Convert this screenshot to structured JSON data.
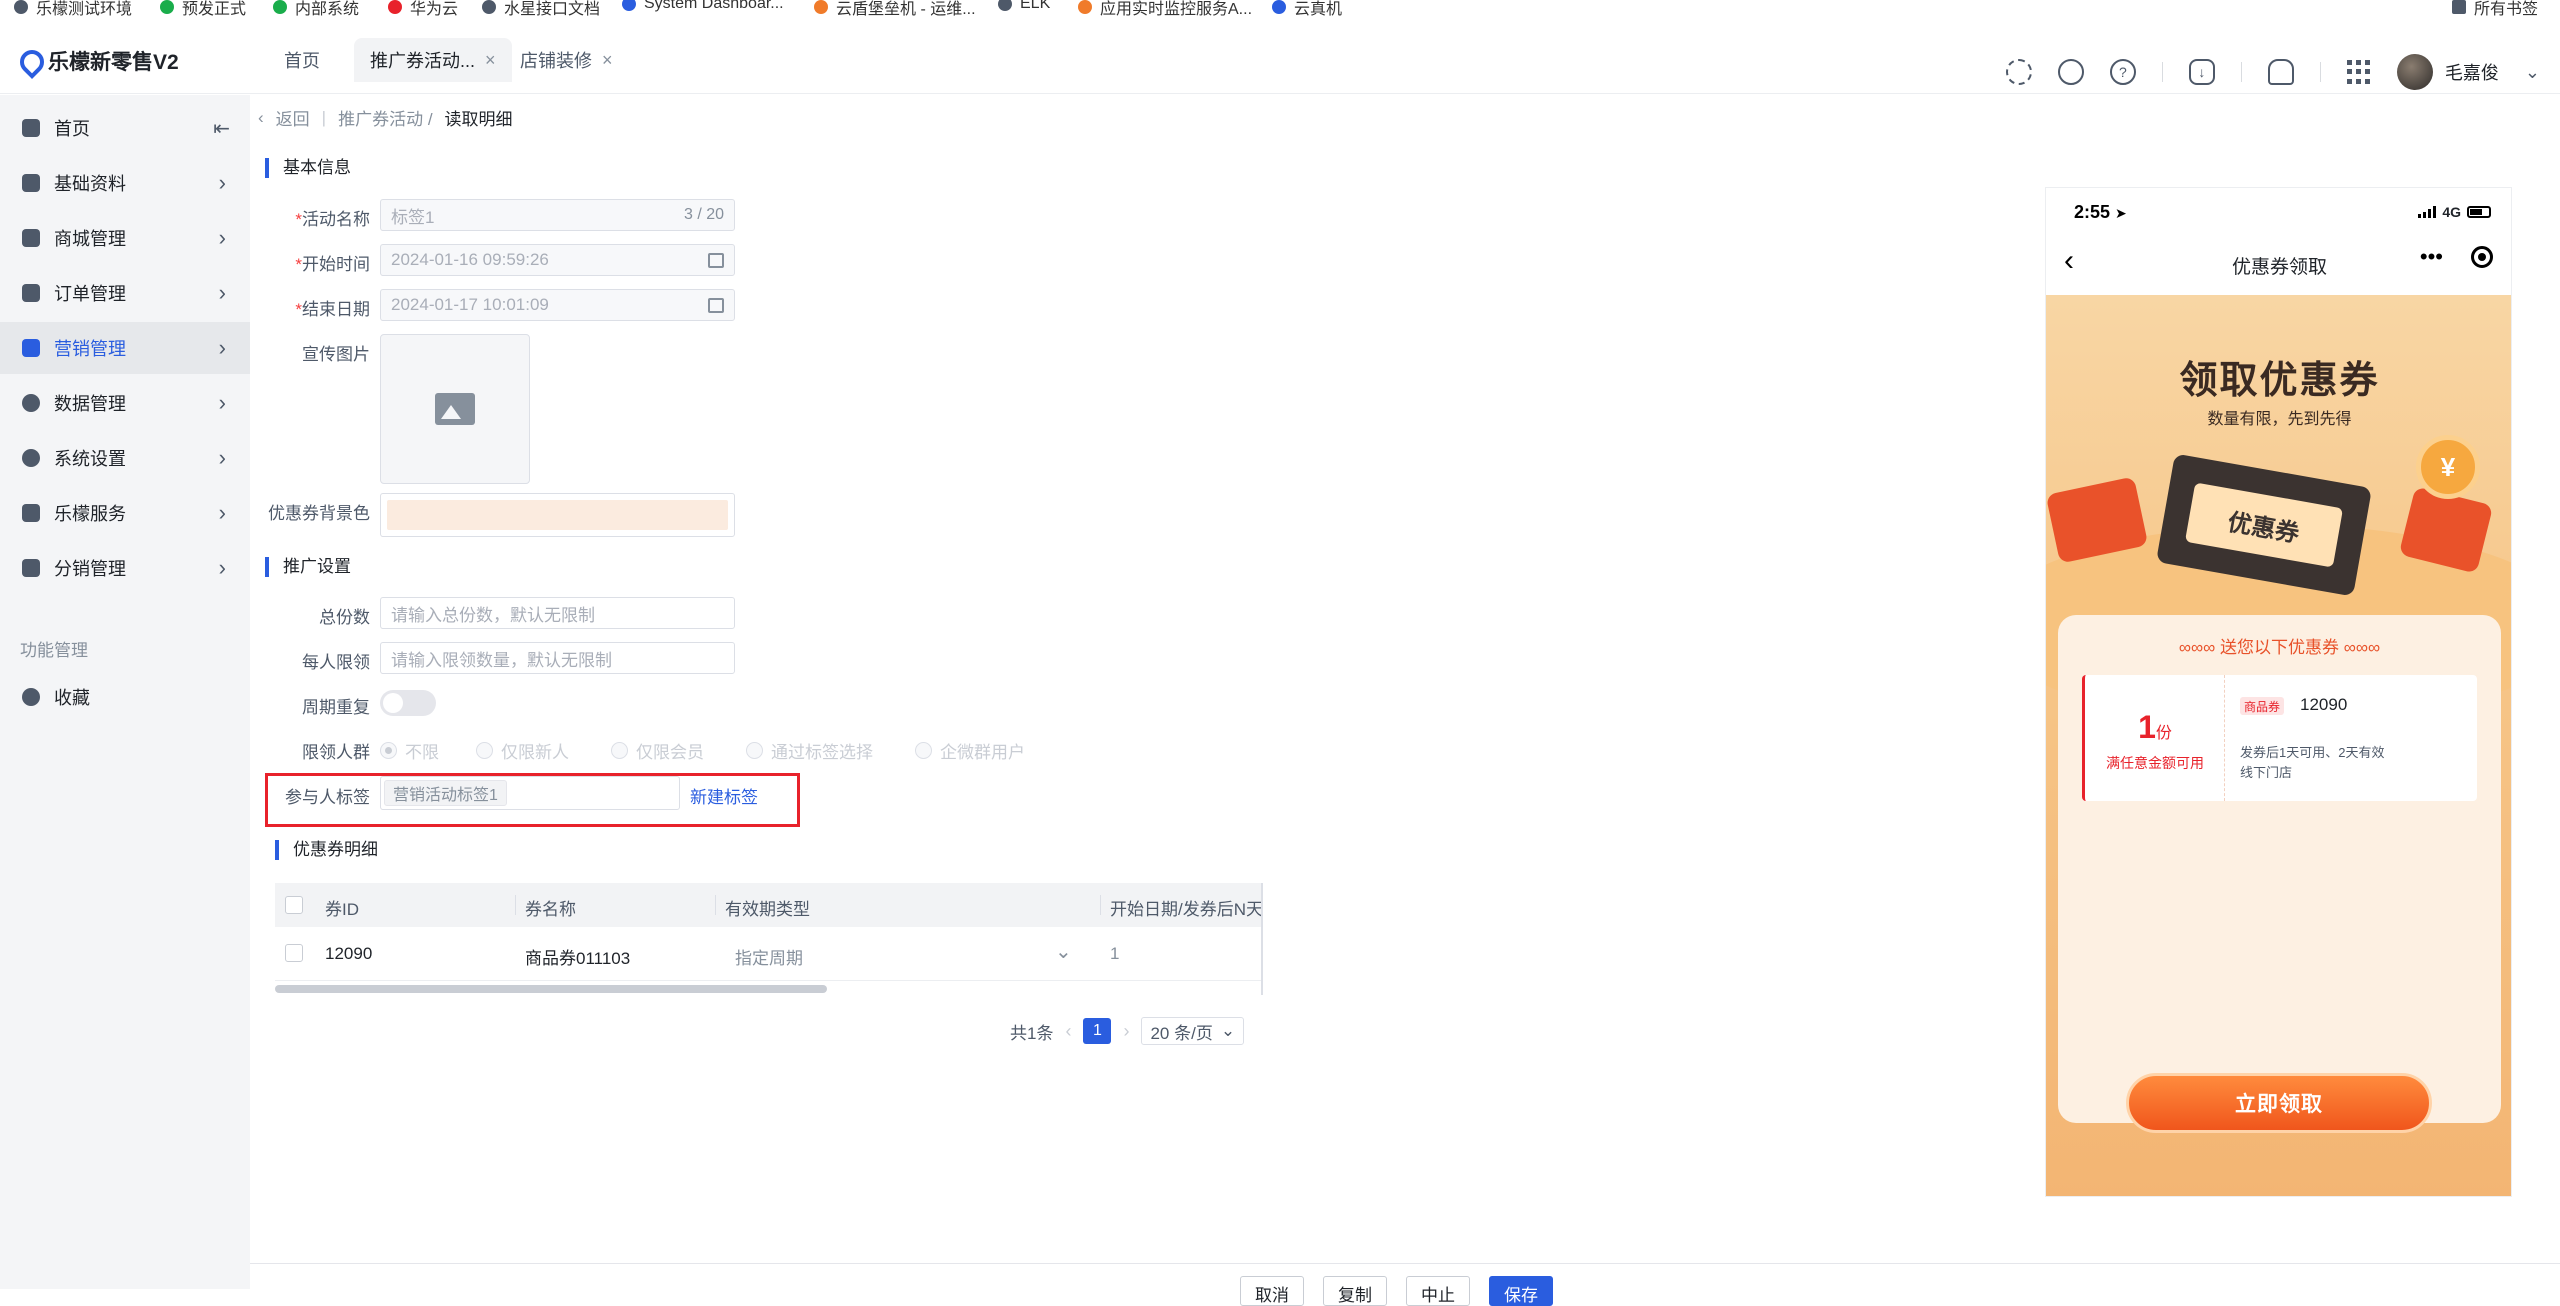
{
  "bookmarks": [
    {
      "label": "乐檬测试环境",
      "color": "#4e5969"
    },
    {
      "label": "预发正式",
      "color": "#1aad4b"
    },
    {
      "label": "内部系统",
      "color": "#1aad4b"
    },
    {
      "label": "华为云",
      "color": "#e8222b"
    },
    {
      "label": "水星接口文档",
      "color": "#4e5969"
    },
    {
      "label": "System Dashboar...",
      "color": "#2a5ddf"
    },
    {
      "label": "云盾堡垒机 - 运维...",
      "color": "#f07b2a"
    },
    {
      "label": "ELK",
      "color": "#4e5969"
    },
    {
      "label": "应用实时监控服务A...",
      "color": "#f07b2a"
    },
    {
      "label": "云真机",
      "color": "#2a5ddf"
    },
    {
      "label": "所有书签",
      "color": "#4e5969"
    }
  ],
  "app": {
    "title": "乐檬新零售V2"
  },
  "tabs": [
    {
      "label": "首页"
    },
    {
      "label": "推广券活动...",
      "close": "×"
    },
    {
      "label": "店铺装修",
      "close": "×"
    }
  ],
  "header": {
    "user": "毛嘉俊"
  },
  "sidebar": {
    "items": [
      {
        "label": "首页"
      },
      {
        "label": "基础资料"
      },
      {
        "label": "商城管理"
      },
      {
        "label": "订单管理"
      },
      {
        "label": "营销管理"
      },
      {
        "label": "数据管理"
      },
      {
        "label": "系统设置"
      },
      {
        "label": "乐檬服务"
      },
      {
        "label": "分销管理"
      }
    ],
    "group_title": "功能管理",
    "group_items": [
      {
        "label": "收藏"
      }
    ]
  },
  "breadcrumb": {
    "back": "返回",
    "parent": "推广券活动 /",
    "current": "读取明细"
  },
  "basic": {
    "title": "基本信息",
    "name_label": "活动名称",
    "name_value": "标签1",
    "name_count": "3 / 20",
    "start_label": "开始时间",
    "start_value": "2024-01-16 09:59:26",
    "end_label": "结束日期",
    "end_value": "2024-01-17 10:01:09",
    "image_label": "宣传图片",
    "bg_label": "优惠券背景色",
    "bg_color": "#fbebdf"
  },
  "promo": {
    "title": "推广设置",
    "total_label": "总份数",
    "total_placeholder": "请输入总份数，默认无限制",
    "per_label": "每人限领",
    "per_placeholder": "请输入限领数量，默认无限制",
    "repeat_label": "周期重复",
    "crowd_label": "限领人群",
    "crowd_options": [
      "不限",
      "仅限新人",
      "仅限会员",
      "通过标签选择",
      "企微群用户"
    ],
    "tag_label": "参与人标签",
    "tag_value": "营销活动标签1",
    "new_tag": "新建标签"
  },
  "detail": {
    "title": "优惠券明细",
    "columns": [
      "券ID",
      "券名称",
      "有效期类型",
      "开始日期/发券后N天"
    ],
    "rows": [
      {
        "id": "12090",
        "name": "商品券011103",
        "type": "指定周期",
        "start": "1"
      }
    ]
  },
  "pagination": {
    "total": "共1条",
    "page": "1",
    "size": "20 条/页"
  },
  "footer": {
    "cancel": "取消",
    "copy": "复制",
    "stop": "中止",
    "save": "保存"
  },
  "phone": {
    "time": "2:55",
    "network": "4G",
    "title": "优惠券领取",
    "headline": "领取优惠券",
    "sub": "数量有限，先到先得",
    "ticket": "优惠券",
    "coin": "¥",
    "card_title": "∞∞∞ 送您以下优惠券 ∞∞∞",
    "coupon_amount": "1",
    "coupon_unit": "份",
    "coupon_condition": "满任意金额可用",
    "coupon_badge": "商品券",
    "coupon_id": "12090",
    "coupon_desc": "发券后1天可用、2天有效 线下门店",
    "button": "立即领取"
  }
}
